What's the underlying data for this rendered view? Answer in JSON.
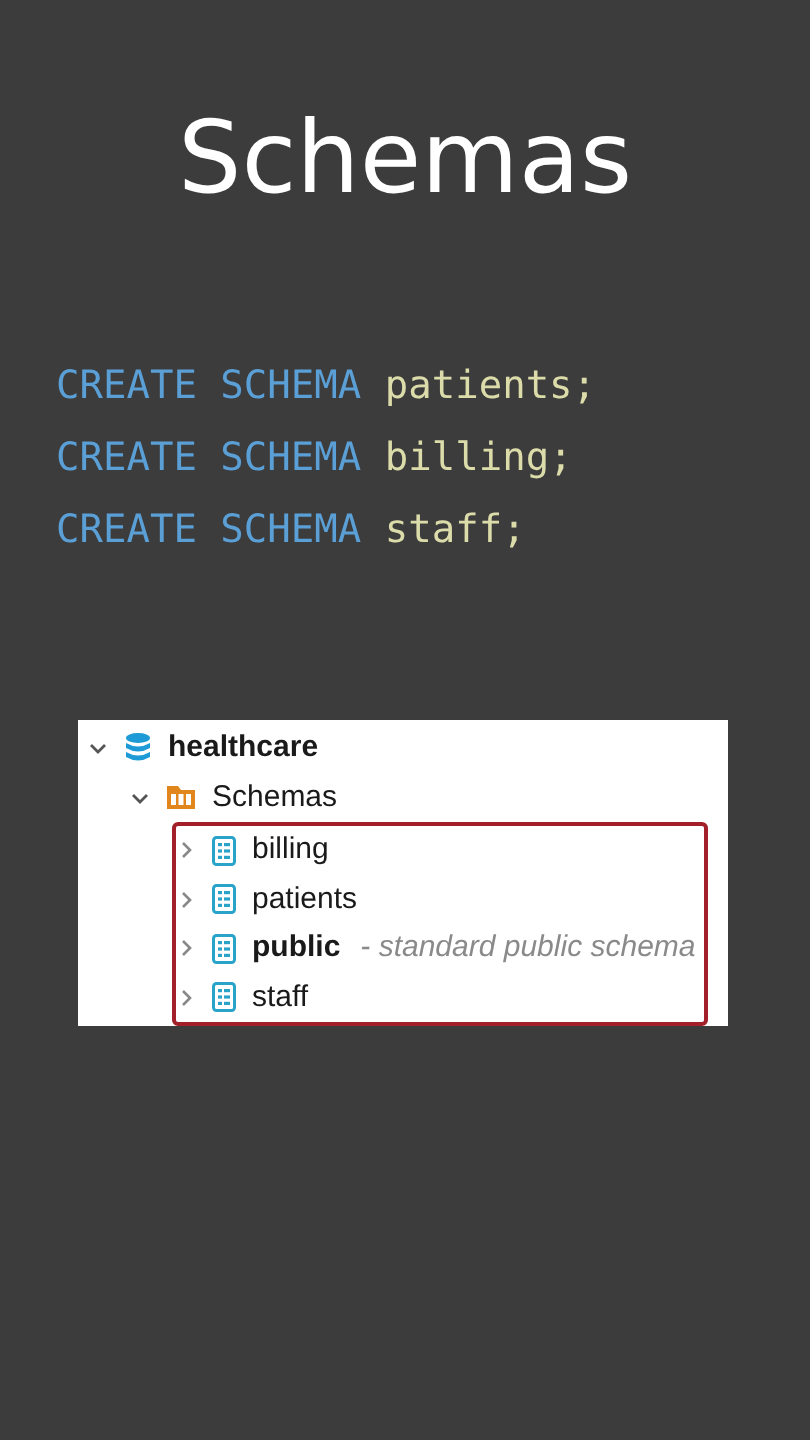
{
  "title": "Schemas",
  "code": [
    {
      "keyword": "CREATE SCHEMA",
      "identifier": "patients;"
    },
    {
      "keyword": "CREATE SCHEMA",
      "identifier": "billing;"
    },
    {
      "keyword": "CREATE SCHEMA",
      "identifier": "staff;"
    }
  ],
  "tree": [
    {
      "label": "healthcare",
      "kind": "database",
      "expanded": true,
      "bold": true,
      "children_highlighted": false,
      "children": [
        {
          "label": "Schemas",
          "kind": "folder",
          "expanded": true,
          "bold": false,
          "children_highlighted": true,
          "children": [
            {
              "label": "billing",
              "kind": "schema",
              "expanded": false,
              "bold": false
            },
            {
              "label": "patients",
              "kind": "schema",
              "expanded": false,
              "bold": false
            },
            {
              "label": "public",
              "kind": "schema",
              "expanded": false,
              "bold": true,
              "description": "- standard public schema"
            },
            {
              "label": "staff",
              "kind": "schema",
              "expanded": false,
              "bold": false
            }
          ]
        }
      ]
    }
  ]
}
